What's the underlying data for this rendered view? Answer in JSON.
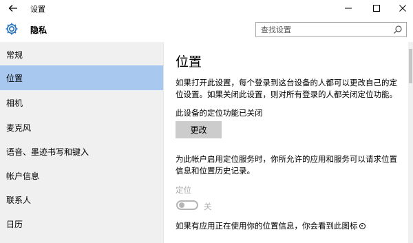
{
  "window": {
    "title": "设置",
    "back_icon": "back-arrow-icon",
    "controls": [
      "minimize-icon",
      "maximize-icon",
      "close-icon"
    ]
  },
  "header": {
    "section_icon": "gear-icon",
    "section_title": "隐私",
    "search_placeholder": "查找设置",
    "search_icon": "search-icon"
  },
  "sidebar": {
    "items": [
      {
        "label": "常规",
        "active": false
      },
      {
        "label": "位置",
        "active": true
      },
      {
        "label": "相机",
        "active": false
      },
      {
        "label": "麦克风",
        "active": false
      },
      {
        "label": "语音、墨迹书写和键入",
        "active": false
      },
      {
        "label": "帐户信息",
        "active": false
      },
      {
        "label": "联系人",
        "active": false
      },
      {
        "label": "日历",
        "active": false
      }
    ]
  },
  "content": {
    "title": "位置",
    "description": "如果打开此设置，每个登录到这台设备的人都可以更改自己的定位设置。如果关闭此设置，则对所有登录的人都关闭定位功能。",
    "device_status": "此设备的定位功能已关闭",
    "change_button": "更改",
    "account_description": "为此帐户启用定位服务时，你所允许的应用和服务可以请求位置信息和位置历史记录。",
    "location_label": "定位",
    "toggle": {
      "state": "off",
      "label": "关"
    },
    "footer_text": "如果有应用正在使用你的位置信息，你会看到此图标"
  },
  "colors": {
    "accent": "#1e6fbe",
    "sidebar_bg": "#f0f0f0",
    "active_item_bg": "#a8c8ef",
    "button_bg": "#cccccc",
    "disabled_text": "#aaaaaa"
  }
}
